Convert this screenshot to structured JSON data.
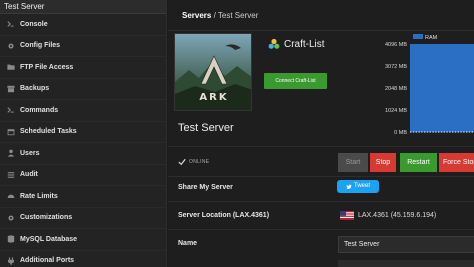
{
  "sidebar": {
    "header": "Test Server",
    "items": [
      {
        "label": "Console",
        "icon": "terminal-icon"
      },
      {
        "label": "Config Files",
        "icon": "gear-icon"
      },
      {
        "label": "FTP File Access",
        "icon": "folder-icon"
      },
      {
        "label": "Backups",
        "icon": "archive-icon"
      },
      {
        "label": "Commands",
        "icon": "terminal-icon"
      },
      {
        "label": "Scheduled Tasks",
        "icon": "calendar-icon"
      },
      {
        "label": "Users",
        "icon": "user-icon"
      },
      {
        "label": "Audit",
        "icon": "list-icon"
      },
      {
        "label": "Rate Limits",
        "icon": "gauge-icon"
      },
      {
        "label": "Customizations",
        "icon": "gear-icon"
      },
      {
        "label": "MySQL Database",
        "icon": "database-icon"
      },
      {
        "label": "Additional Ports",
        "icon": "plug-icon"
      }
    ]
  },
  "breadcrumb": {
    "root": "Servers",
    "separator": "/",
    "current": "Test Server"
  },
  "game": {
    "image_text": "ARK"
  },
  "craftlist": {
    "title": "Craft-List",
    "connect_label": "Connect Craft-List"
  },
  "server": {
    "title": "Test Server",
    "status": "ONLINE"
  },
  "controls": {
    "start": "Start",
    "stop": "Stop",
    "restart": "Restart",
    "force_stop": "Force Stop"
  },
  "share": {
    "label": "Share My Server",
    "tweet": "Tweet"
  },
  "location": {
    "label": "Server Location (LAX.4361)",
    "value": "LAX.4361 (45.159.6.194)"
  },
  "name": {
    "label": "Name",
    "value": "Test Server"
  },
  "chart_data": {
    "type": "area",
    "yticks": [
      "4096 MB",
      "3072 MB",
      "2048 MB",
      "1024 MB",
      "0 MB"
    ],
    "ylim": [
      0,
      4096
    ],
    "legend": "RAM",
    "values": [
      4096,
      4096,
      4096,
      4096,
      4096,
      4096,
      4096,
      4096
    ],
    "colors": {
      "fill": "#2a6fc4",
      "line": "#5aa0ff"
    }
  },
  "colors": {
    "accent_green": "#3b9a2e",
    "accent_red": "#d63a32",
    "twitter": "#1da1f2"
  }
}
